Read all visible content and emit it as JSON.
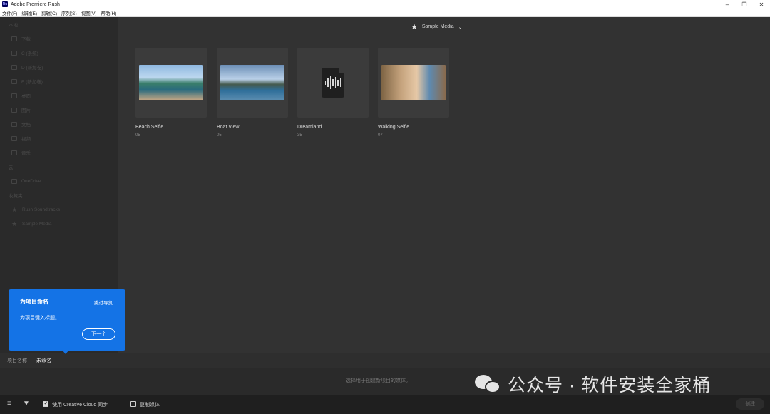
{
  "window": {
    "title": "Adobe Premiere Rush",
    "app_icon": "Ru",
    "controls": [
      "–",
      "❐",
      "✕"
    ]
  },
  "menu": [
    "文件(F)",
    "编辑(E)",
    "剪辑(C)",
    "序列(S)",
    "视图(V)",
    "帮助(H)"
  ],
  "sidebar": {
    "section_local": "本地",
    "local_items": [
      {
        "label": "下载",
        "icon": "download-icon"
      },
      {
        "label": "C (系统)",
        "icon": "drive-icon"
      },
      {
        "label": "D (新加卷)",
        "icon": "drive-icon"
      },
      {
        "label": "E (新加卷)",
        "icon": "drive-icon"
      },
      {
        "label": "桌面",
        "icon": "desktop-icon"
      },
      {
        "label": "图片",
        "icon": "pictures-icon"
      },
      {
        "label": "文档",
        "icon": "documents-icon"
      },
      {
        "label": "视频",
        "icon": "videos-icon"
      },
      {
        "label": "音乐",
        "icon": "music-icon"
      }
    ],
    "section_cloud": "云",
    "cloud_items": [
      {
        "label": "OneDrive",
        "icon": "cloud-icon"
      }
    ],
    "section_favorites": "收藏夹",
    "favorite_items": [
      {
        "label": "Rush Soundtracks",
        "icon": "star-icon"
      },
      {
        "label": "Sample Media",
        "icon": "star-icon"
      }
    ]
  },
  "main": {
    "source_label": "Sample Media",
    "media": [
      {
        "name": "Beach Selfie",
        "duration": "05",
        "kind": "video"
      },
      {
        "name": "Boat View",
        "duration": "05",
        "kind": "video"
      },
      {
        "name": "Dreamland",
        "duration": "35",
        "kind": "audio"
      },
      {
        "name": "Walking Selfie",
        "duration": "07",
        "kind": "video"
      }
    ]
  },
  "project": {
    "label": "项目名称",
    "value": "未命名"
  },
  "hint": "选择用于创建新项目的媒体。",
  "bottom": {
    "sync_label": "使用 Creative Cloud 同步",
    "sync_checked": true,
    "copy_label": "复制媒体",
    "copy_checked": false,
    "create_label": "创建"
  },
  "coach": {
    "title": "为项目命名",
    "skip": "跳过导览",
    "body": "为项目键入标题。",
    "next": "下一个"
  },
  "watermark": "公众号 · 软件安装全家桶",
  "colors": {
    "accent": "#1473e6"
  }
}
